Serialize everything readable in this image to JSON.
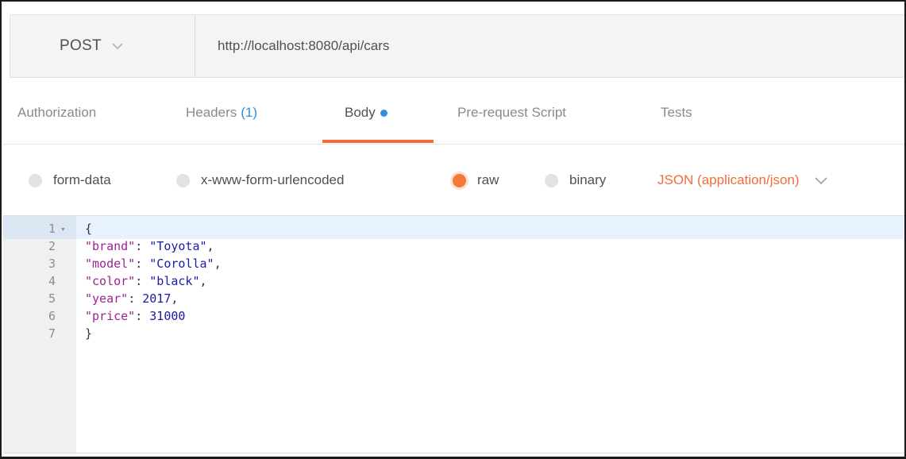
{
  "request": {
    "method": "POST",
    "url": "http://localhost:8080/api/cars"
  },
  "tabs": [
    {
      "label": "Authorization"
    },
    {
      "label": "Headers",
      "count": "(1)"
    },
    {
      "label": "Body",
      "active": true
    },
    {
      "label": "Pre-request Script"
    },
    {
      "label": "Tests"
    }
  ],
  "body_type": {
    "options": [
      {
        "label": "form-data",
        "checked": false
      },
      {
        "label": "x-www-form-urlencoded",
        "checked": false
      },
      {
        "label": "raw",
        "checked": true
      },
      {
        "label": "binary",
        "checked": false
      }
    ],
    "content_type": "JSON (application/json)"
  },
  "editor": {
    "lines": [
      {
        "num": "1",
        "fold": "▾",
        "tokens": [
          {
            "t": "p",
            "v": "{"
          }
        ]
      },
      {
        "num": "2",
        "tokens": [
          {
            "t": "k",
            "v": "\"brand\""
          },
          {
            "t": "p",
            "v": ": "
          },
          {
            "t": "s",
            "v": "\"Toyota\""
          },
          {
            "t": "p",
            "v": ","
          }
        ]
      },
      {
        "num": "3",
        "tokens": [
          {
            "t": "k",
            "v": "\"model\""
          },
          {
            "t": "p",
            "v": ": "
          },
          {
            "t": "s",
            "v": "\"Corolla\""
          },
          {
            "t": "p",
            "v": ","
          }
        ]
      },
      {
        "num": "4",
        "tokens": [
          {
            "t": "k",
            "v": "\"color\""
          },
          {
            "t": "p",
            "v": ": "
          },
          {
            "t": "s",
            "v": "\"black\""
          },
          {
            "t": "p",
            "v": ","
          }
        ]
      },
      {
        "num": "5",
        "tokens": [
          {
            "t": "k",
            "v": "\"year\""
          },
          {
            "t": "p",
            "v": ": "
          },
          {
            "t": "n",
            "v": "2017"
          },
          {
            "t": "p",
            "v": ","
          }
        ]
      },
      {
        "num": "6",
        "tokens": [
          {
            "t": "k",
            "v": "\"price\""
          },
          {
            "t": "p",
            "v": ": "
          },
          {
            "t": "n",
            "v": "31000"
          }
        ]
      },
      {
        "num": "7",
        "tokens": [
          {
            "t": "p",
            "v": "}"
          }
        ]
      }
    ]
  },
  "colors": {
    "accent": "#f26b3a",
    "link_blue": "#2f8fdf"
  },
  "icons": {
    "method_dropdown": "chevron-down-icon",
    "content_type_dropdown": "chevron-down-icon",
    "body_indicator": "dot-icon"
  }
}
